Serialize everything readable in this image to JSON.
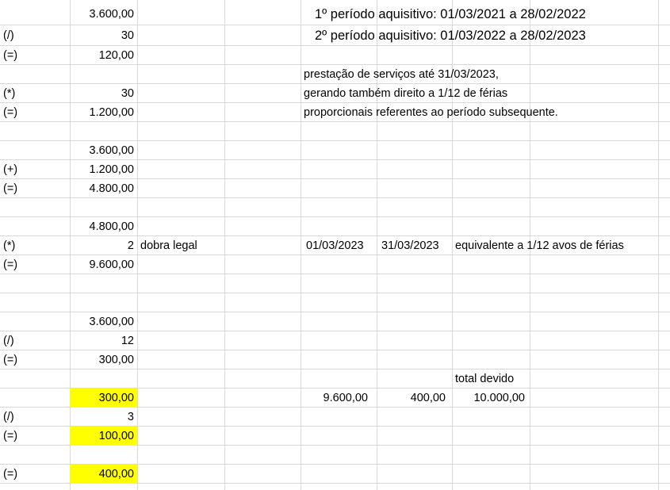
{
  "rows": [
    {
      "op": "",
      "value": "3.600,00"
    },
    {
      "op": "(/)",
      "value": "30"
    },
    {
      "op": "(=)",
      "value": "120,00"
    },
    {
      "op": "",
      "value": ""
    },
    {
      "op": "(*)",
      "value": "30"
    },
    {
      "op": "(=)",
      "value": "1.200,00"
    },
    {
      "op": "",
      "value": ""
    },
    {
      "op": "",
      "value": "3.600,00"
    },
    {
      "op": "(+)",
      "value": "1.200,00"
    },
    {
      "op": "(=)",
      "value": "4.800,00"
    },
    {
      "op": "",
      "value": ""
    },
    {
      "op": "",
      "value": "4.800,00"
    },
    {
      "op": "(*)",
      "value": "2"
    },
    {
      "op": "(=)",
      "value": "9.600,00"
    },
    {
      "op": "",
      "value": ""
    },
    {
      "op": "",
      "value": ""
    },
    {
      "op": "",
      "value": "3.600,00"
    },
    {
      "op": "(/)",
      "value": "12"
    },
    {
      "op": "(=)",
      "value": "300,00"
    },
    {
      "op": "",
      "value": ""
    },
    {
      "op": "",
      "value": "300,00"
    },
    {
      "op": "(/)",
      "value": "3"
    },
    {
      "op": "(=)",
      "value": "100,00"
    },
    {
      "op": "",
      "value": ""
    },
    {
      "op": "(=)",
      "value": "400,00"
    }
  ],
  "highlight_color": "#ffff00",
  "notes": {
    "periodo1": "1º período aquisitivo: 01/03/2021 a 28/02/2022",
    "periodo2": "2º período aquisitivo: 01/03/2022 a 28/02/2023",
    "prestacao1": "prestação de serviços até 31/03/2023,",
    "prestacao2": "gerando também direito a 1/12 de férias",
    "prestacao3": "proporcionais referentes ao período subsequente.",
    "dobra_legal": "dobra legal",
    "data_inicio": "01/03/2023",
    "data_fim": "31/03/2023",
    "equivalente": "equivalente a 1/12 avos de férias",
    "total_devido_label": "total devido"
  },
  "totals": {
    "dobra": "9.600,00",
    "proporcional": "400,00",
    "total": "10.000,00"
  }
}
